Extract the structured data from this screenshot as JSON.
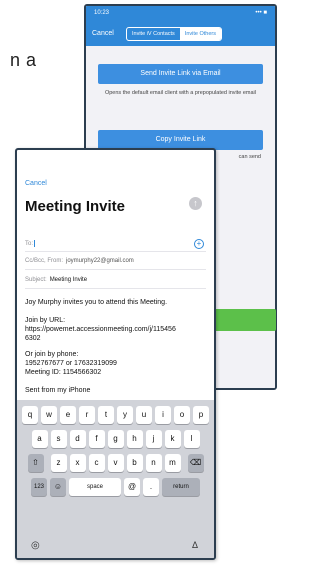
{
  "background_text": "n a",
  "back_screen": {
    "status_time": "10:23",
    "status_icons": "••• ■",
    "cancel": "Cancel",
    "tab_contacts": "Invite iV Contacts",
    "tab_others": "Invite Others",
    "send_email_button": "Send Invite Link via Email",
    "email_note": "Opens the default email client with a prepopulated invite email",
    "copy_link_button": "Copy Invite Link",
    "copy_note": "can send"
  },
  "email": {
    "cancel": "Cancel",
    "title": "Meeting Invite",
    "to_label": "To:",
    "cc_label": "Cc/Bcc, From:",
    "cc_value": "joymurphy22@gmail.com",
    "subject_label": "Subject:",
    "subject_value": "Meeting Invite",
    "body_intro": "Joy Murphy invites you to attend this Meeting.",
    "body_join_url": "Join by URL:\nhttps://powemet.accessionmeeting.com/j/115456\n6302",
    "body_join_phone": "Or join by phone:\n1952767677 or 17632319099\nMeeting ID: 1154566302",
    "signature": "Sent from my iPhone"
  },
  "keyboard": {
    "row1": [
      "q",
      "w",
      "e",
      "r",
      "t",
      "y",
      "u",
      "i",
      "o",
      "p"
    ],
    "row2": [
      "a",
      "s",
      "d",
      "f",
      "g",
      "h",
      "j",
      "k",
      "l"
    ],
    "row3": [
      "z",
      "x",
      "c",
      "v",
      "b",
      "n",
      "m"
    ],
    "shift": "⇧",
    "delete": "⌫",
    "numbers": "123",
    "emoji": "☺",
    "space": "space",
    "at": "@",
    "dot": ".",
    "return": "return",
    "globe": "◎",
    "mic": "Δ"
  },
  "colors": {
    "accent": "#2f88d8",
    "green": "#5cc04a"
  }
}
